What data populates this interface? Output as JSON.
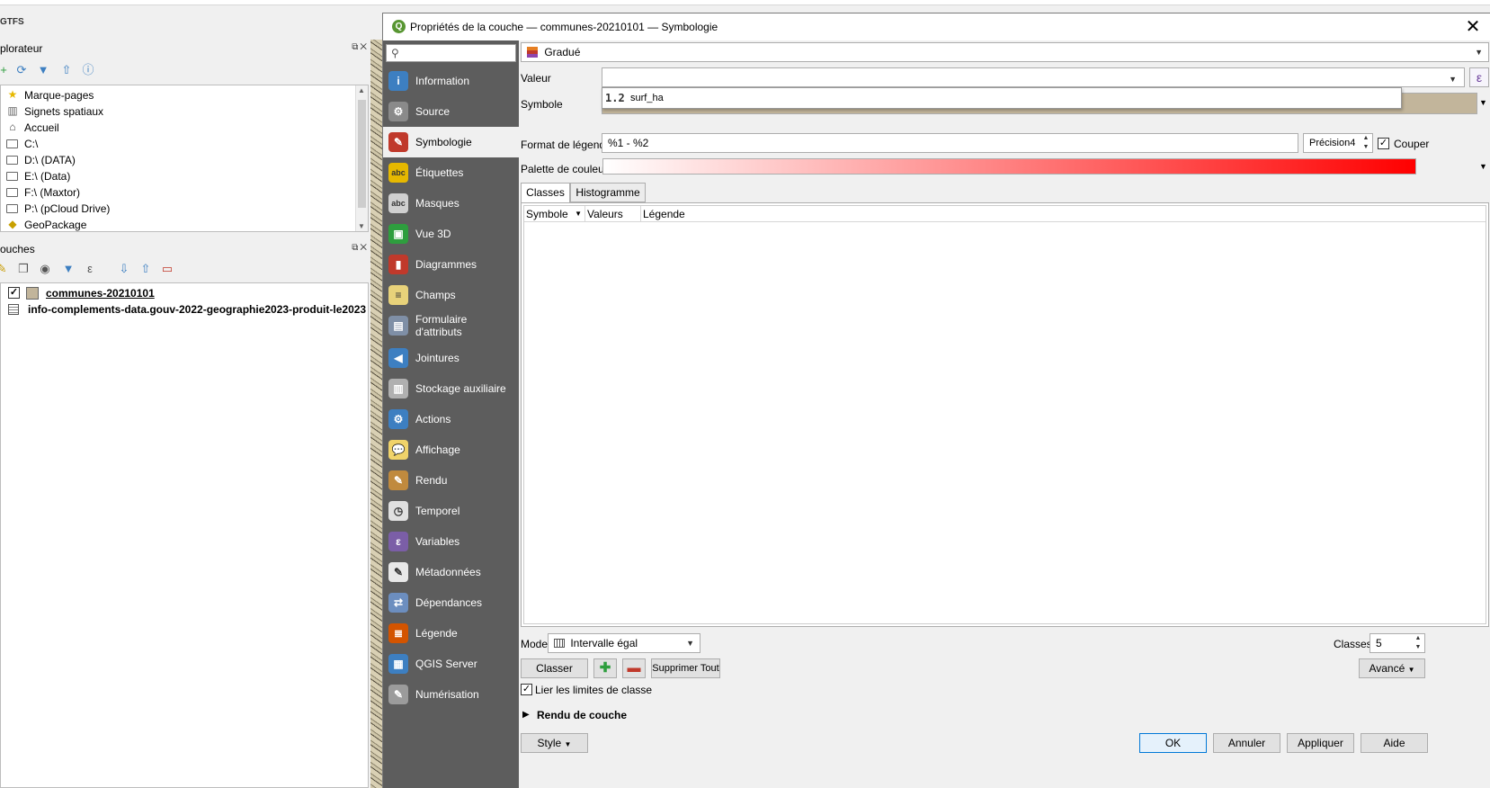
{
  "main": {
    "gtfs_label": "GTFS",
    "browser_title": "plorateur",
    "layers_title": "ouches",
    "browser_items": [
      {
        "label": "Marque-pages",
        "icon": "star-icon"
      },
      {
        "label": "Signets spatiaux",
        "icon": "spatial-bookmark-icon"
      },
      {
        "label": "Accueil",
        "icon": "home-icon"
      },
      {
        "label": "C:\\",
        "icon": "folder-icon"
      },
      {
        "label": "D:\\ (DATA)",
        "icon": "folder-icon"
      },
      {
        "label": "E:\\ (Data)",
        "icon": "folder-icon"
      },
      {
        "label": "F:\\ (Maxtor)",
        "icon": "folder-icon"
      },
      {
        "label": "P:\\ (pCloud Drive)",
        "icon": "folder-icon"
      },
      {
        "label": "GeoPackage",
        "icon": "geopackage-icon"
      }
    ],
    "layers": [
      {
        "label": "communes-20210101",
        "checked": true
      },
      {
        "label": "info-complements-data.gouv-2022-geographie2023-produit-le2023"
      }
    ]
  },
  "dialog": {
    "title": "Propriétés de la couche — communes-20210101 — Symbologie",
    "search_placeholder": "",
    "nav_items": [
      {
        "label": "Information",
        "icon": "information-icon",
        "color": "#3d7fc1"
      },
      {
        "label": "Source",
        "icon": "source-icon",
        "color": "#8a8a8a"
      },
      {
        "label": "Symbologie",
        "icon": "symbology-icon",
        "color": "#c0392b",
        "active": true
      },
      {
        "label": "Étiquettes",
        "icon": "labels-icon",
        "color": "#e6b800"
      },
      {
        "label": "Masques",
        "icon": "masks-icon",
        "color": "#cfcfcf"
      },
      {
        "label": "Vue 3D",
        "icon": "3d-view-icon",
        "color": "#2e9e3e"
      },
      {
        "label": "Diagrammes",
        "icon": "diagrams-icon",
        "color": "#c0392b"
      },
      {
        "label": "Champs",
        "icon": "fields-icon",
        "color": "#e8d27a"
      },
      {
        "label": "Formulaire d'attributs",
        "icon": "attribute-form-icon",
        "color": "#7f8fa6"
      },
      {
        "label": "Jointures",
        "icon": "joins-icon",
        "color": "#3d7fc1"
      },
      {
        "label": "Stockage auxiliaire",
        "icon": "auxiliary-storage-icon",
        "color": "#b0b0b0"
      },
      {
        "label": "Actions",
        "icon": "actions-icon",
        "color": "#3d7fc1"
      },
      {
        "label": "Affichage",
        "icon": "display-icon",
        "color": "#f0d36a"
      },
      {
        "label": "Rendu",
        "icon": "rendering-icon",
        "color": "#c08a3e"
      },
      {
        "label": "Temporel",
        "icon": "temporal-icon",
        "color": "#e0e0e0"
      },
      {
        "label": "Variables",
        "icon": "variables-icon",
        "color": "#7b5ea7"
      },
      {
        "label": "Métadonnées",
        "icon": "metadata-icon",
        "color": "#e8e8e8"
      },
      {
        "label": "Dépendances",
        "icon": "dependencies-icon",
        "color": "#6c8ebf"
      },
      {
        "label": "Légende",
        "icon": "legend-icon",
        "color": "#d35400"
      },
      {
        "label": "QGIS Server",
        "icon": "qgis-server-icon",
        "color": "#3d7fc1"
      },
      {
        "label": "Numérisation",
        "icon": "digitizing-icon",
        "color": "#9b9b9b"
      }
    ],
    "renderer": "Gradué",
    "value_label": "Valeur",
    "value_input": "",
    "dropdown_field": {
      "type": "1.2",
      "name": "surf_ha"
    },
    "symbol_label": "Symbole",
    "legend_format_label": "Format de légende",
    "legend_format_value": "%1 - %2",
    "precision_label": "Précision",
    "precision_value": "4",
    "trim_label": "Couper",
    "color_ramp_label": "Palette de couleur",
    "color_ramp": {
      "start": "#ffffff",
      "end": "#ff0000"
    },
    "tabs": [
      "Classes",
      "Histogramme"
    ],
    "table_headers": [
      "Symbole",
      "Valeurs",
      "Légende"
    ],
    "mode_label": "Mode",
    "mode_value": "Intervalle égal",
    "classes_label": "Classes",
    "classes_value": "5",
    "classify_button": "Classer",
    "delete_all_button": "Supprimer Tout",
    "advanced_button": "Avancé",
    "link_class_limits": "Lier les limites de classe",
    "layer_rendering": "Rendu de couche",
    "style_button": "Style",
    "ok_button": "OK",
    "cancel_button": "Annuler",
    "apply_button": "Appliquer",
    "help_button": "Aide"
  }
}
